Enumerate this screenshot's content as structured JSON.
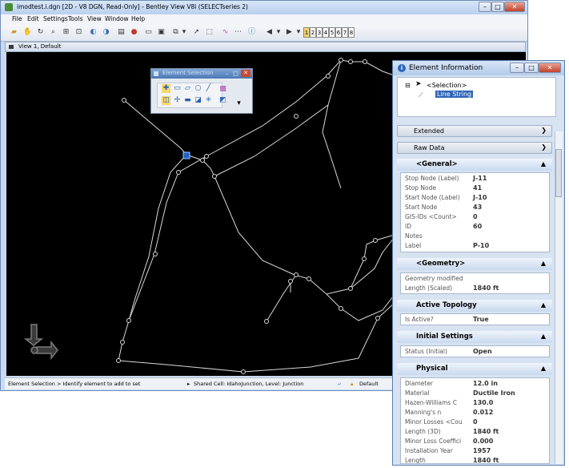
{
  "main": {
    "title": "imodtest.i.dgn [2D - V8 DGN, Read-Only] - Bentley View V8i (SELECTseries 2)",
    "window_buttons": {
      "minimize": "–",
      "maximize": "□",
      "close": "✕"
    },
    "menu": [
      "File",
      "Edit",
      "Settings",
      "Tools",
      "View",
      "Window",
      "Help"
    ],
    "view_numbers": [
      "1",
      "2",
      "3",
      "4",
      "5",
      "6",
      "7",
      "8"
    ],
    "view_title": "View 1, Default",
    "status": {
      "left": "Element Selection > Identify element to add to set",
      "center": "Shared Cell: IdahoJunction, Level: Junction",
      "right": "Default"
    }
  },
  "element_selection": {
    "title": "Element Selection"
  },
  "element_info": {
    "title": "Element Information",
    "tree": {
      "root": "<Selection>",
      "child": "Line String"
    },
    "sections": {
      "extended": "Extended",
      "raw_data": "Raw Data"
    },
    "groups": {
      "general": {
        "title": "<General>",
        "rows": [
          {
            "k": "Stop Node (Label)",
            "v": "J-11"
          },
          {
            "k": "Stop Node",
            "v": "41"
          },
          {
            "k": "Start Node (Label)",
            "v": "J-10"
          },
          {
            "k": "Start Node",
            "v": "43"
          },
          {
            "k": "GIS-IDs <Count>",
            "v": "0"
          },
          {
            "k": "ID",
            "v": "60"
          },
          {
            "k": "Notes",
            "v": ""
          },
          {
            "k": "Label",
            "v": "P-10"
          }
        ]
      },
      "geometry": {
        "title": "<Geometry>",
        "rows": [
          {
            "k": "Geometry modified",
            "v": ""
          },
          {
            "k": "Length (Scaled)",
            "v": "1840 ft"
          }
        ]
      },
      "active_topology": {
        "title": "Active Topology",
        "rows": [
          {
            "k": "Is Active?",
            "v": "True"
          }
        ]
      },
      "initial_settings": {
        "title": "Initial Settings",
        "rows": [
          {
            "k": "Status (Initial)",
            "v": "Open"
          }
        ]
      },
      "physical": {
        "title": "Physical",
        "rows": [
          {
            "k": "Diameter",
            "v": "12.0 in"
          },
          {
            "k": "Material",
            "v": "Ductile Iron"
          },
          {
            "k": "Hazen-Williams C",
            "v": "130.0"
          },
          {
            "k": "Manning's n",
            "v": "0.012"
          },
          {
            "k": "Minor Losses <Cou",
            "v": "0"
          },
          {
            "k": "Length (3D)",
            "v": "1840 ft"
          },
          {
            "k": "Minor Loss Coeffici",
            "v": "0.000"
          },
          {
            "k": "Installation Year",
            "v": "1957"
          },
          {
            "k": "Length",
            "v": "1840 ft"
          }
        ]
      }
    }
  },
  "colors": {
    "canvas": "#000000",
    "network": "#e0e0e0",
    "selection_blue": "#1f5fc6"
  }
}
